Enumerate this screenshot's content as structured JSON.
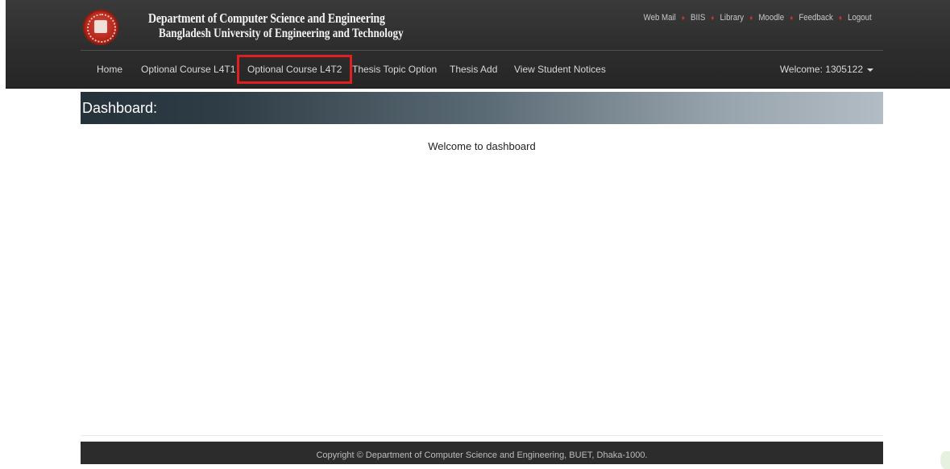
{
  "header": {
    "dept_title": "Department of Computer Science and Engineering",
    "uni_title": "Bangladesh University of Engineering and Technology",
    "top_links": [
      "Web Mail",
      "BIIS",
      "Library",
      "Moodle",
      "Feedback",
      "Logout"
    ],
    "top_link_separator": "♦"
  },
  "nav": {
    "items": [
      {
        "label": "Home"
      },
      {
        "label": "Optional Course L4T1"
      },
      {
        "label": "Optional Course L4T2",
        "highlighted": true
      },
      {
        "label": "Thesis Topic Option"
      },
      {
        "label": "Thesis Add"
      },
      {
        "label": "View Student Notices"
      }
    ],
    "welcome": "Welcome: 1305122"
  },
  "dashboard": {
    "title": "Dashboard:",
    "message": "Welcome to dashboard"
  },
  "footer": {
    "text": "Copyright © Department of Computer Science and Engineering, BUET, Dhaka-1000."
  },
  "colors": {
    "header_bg": "#2d2d2d",
    "highlight_border": "#e02020",
    "separator": "#c0392b",
    "footer_bg": "#2c2c2c"
  }
}
